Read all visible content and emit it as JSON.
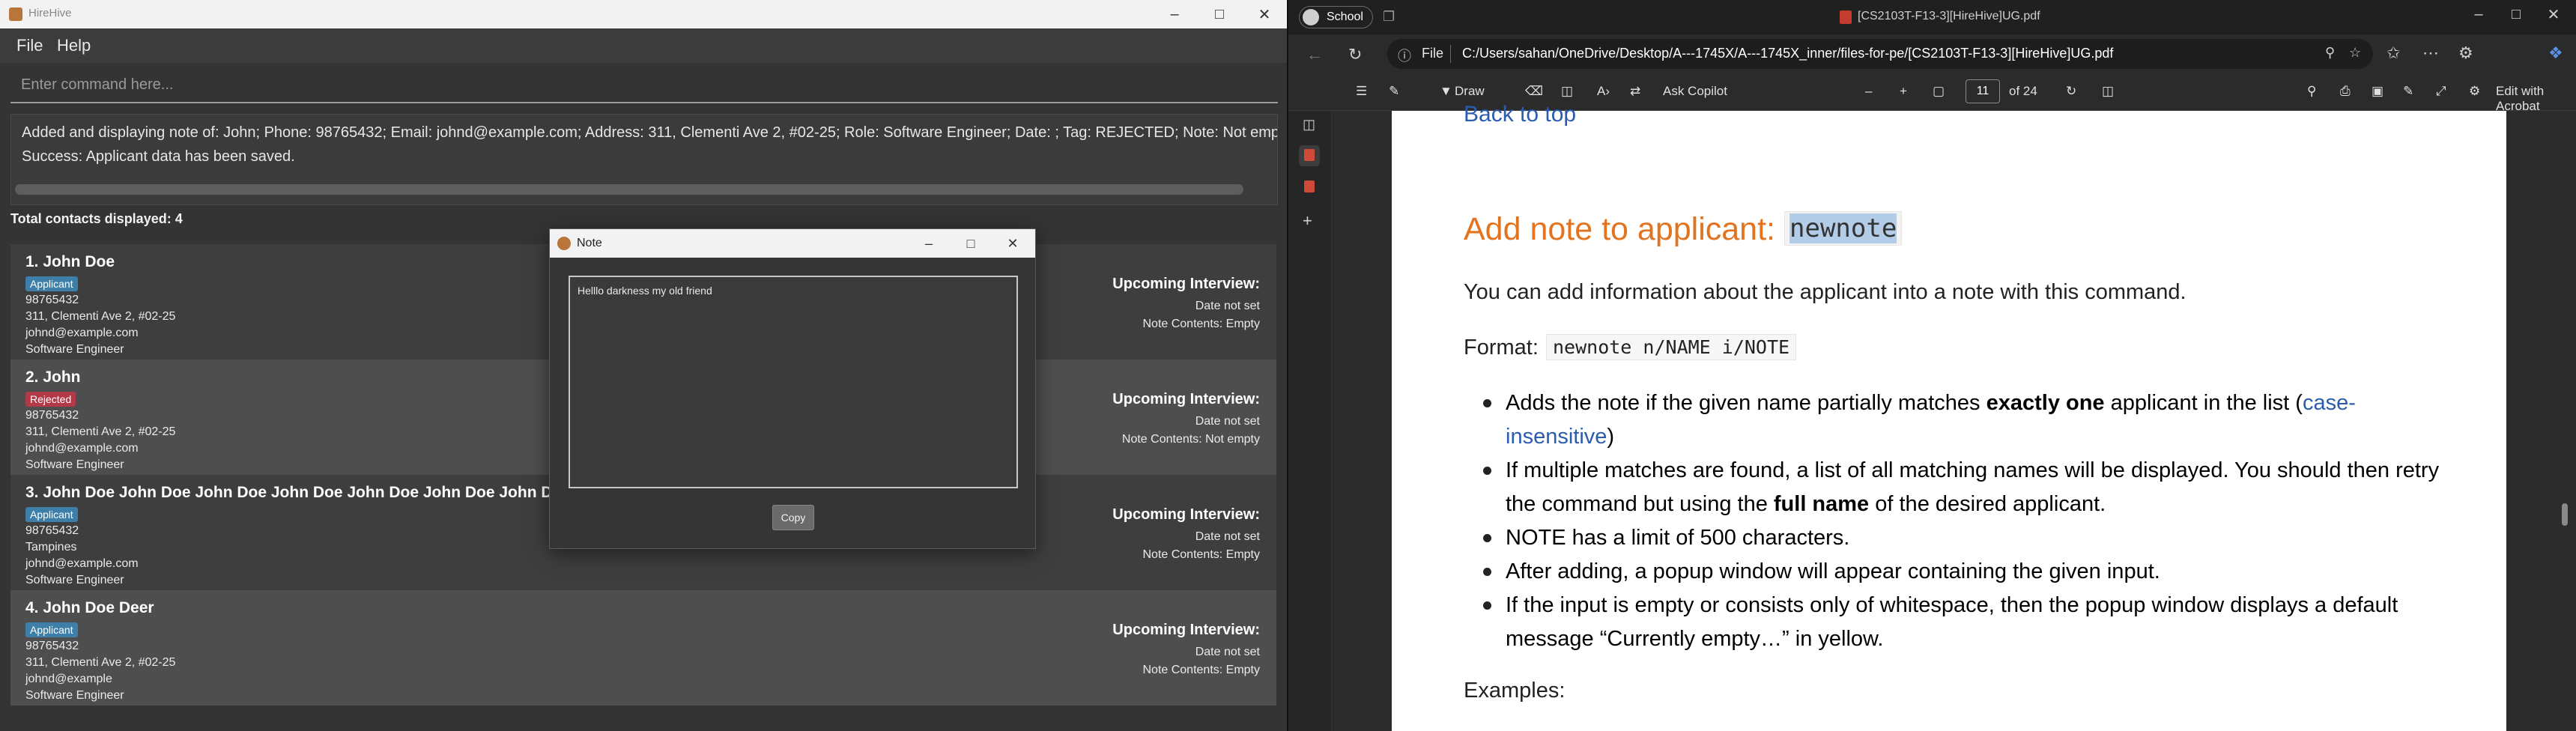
{
  "hirehive": {
    "window_title": "HireHive",
    "menu": [
      "File",
      "Help"
    ],
    "command_placeholder": "Enter command here...",
    "result_line1": "Added and displaying note of: John; Phone: 98765432; Email: johnd@example.com; Address: 311, Clementi Ave 2, #02-25; Role: Software Engineer; Date: ; Tag: REJECTED; Note: Not emp",
    "result_line2": "Success: Applicant data has been saved.",
    "total_contacts": "Total contacts displayed: 4",
    "persons": [
      {
        "name": "1. John Doe",
        "tag": "Applicant",
        "tag_color": "#3d7fa8",
        "phone": "98765432",
        "address": "311, Clementi Ave 2, #02-25",
        "email": "johnd@example.com",
        "role": "Software Engineer",
        "interview_title": "Upcoming Interview:",
        "date": "Date not set",
        "note": "Note Contents: Empty"
      },
      {
        "name": "2. John",
        "tag": "Rejected",
        "tag_color": "#b23a48",
        "phone": "98765432",
        "address": "311, Clementi Ave 2, #02-25",
        "email": "johnd@example.com",
        "role": "Software Engineer",
        "interview_title": "Upcoming Interview:",
        "date": "Date not set",
        "note": "Note Contents: Not empty"
      },
      {
        "name": "3. John Doe John Doe John Doe John Doe John Doe John Doe John Doe",
        "tag": "Applicant",
        "tag_color": "#3d7fa8",
        "phone": "98765432",
        "address": "Tampines",
        "email": "johnd@example.com",
        "role": "Software Engineer",
        "interview_title": "Upcoming Interview:",
        "date": "Date not set",
        "note": "Note Contents: Empty"
      },
      {
        "name": "4. John Doe Deer",
        "tag": "Applicant",
        "tag_color": "#3d7fa8",
        "phone": "98765432",
        "address": "311, Clementi Ave 2, #02-25",
        "email": "johnd@example",
        "role": "Software Engineer",
        "interview_title": "Upcoming Interview:",
        "date": "Date not set",
        "note": "Note Contents: Empty"
      }
    ]
  },
  "note_popup": {
    "title": "Note",
    "content": "Helllo darkness my old friend",
    "copy_label": "Copy"
  },
  "edge": {
    "profile": "School",
    "tab_title": "[CS2103T-F13-3][HireHive]UG.pdf",
    "url_scheme": "File",
    "url_path": "C:/Users/sahan/OneDrive/Desktop/A---1745X/A---1745X_inner/files-for-pe/[CS2103T-F13-3][HireHive]UG.pdf",
    "toolbar": {
      "draw": "Draw",
      "ask_copilot": "Ask Copilot",
      "page_current": "11",
      "page_total": "of 24",
      "edit_acrobat": "Edit with Acrobat"
    }
  },
  "pdf": {
    "back_to_top": "Back to top",
    "heading": "Add note to applicant: ",
    "heading_code": "newnote",
    "description": "You can add information about the applicant into a note with this command.",
    "format_label": "Format:",
    "format_code": "newnote n/NAME i/NOTE",
    "bullets": {
      "b1_pre": "Adds the note if the given name partially matches ",
      "b1_bold": "exactly one",
      "b1_mid": " applicant in the list (",
      "b1_link": "case-insensitive",
      "b1_post": ")",
      "b2_pre": "If multiple matches are found, a list of all matching names will be displayed. You should then retry the command but using the ",
      "b2_bold": "full name",
      "b2_post": " of the desired applicant.",
      "b3": "NOTE has a limit of 500 characters.",
      "b4": "After adding, a popup window will appear containing the given input.",
      "b5": "If the input is empty or consists only of whitespace, then the popup window displays a default message “Currently empty…” in yellow."
    },
    "examples": "Examples:"
  }
}
